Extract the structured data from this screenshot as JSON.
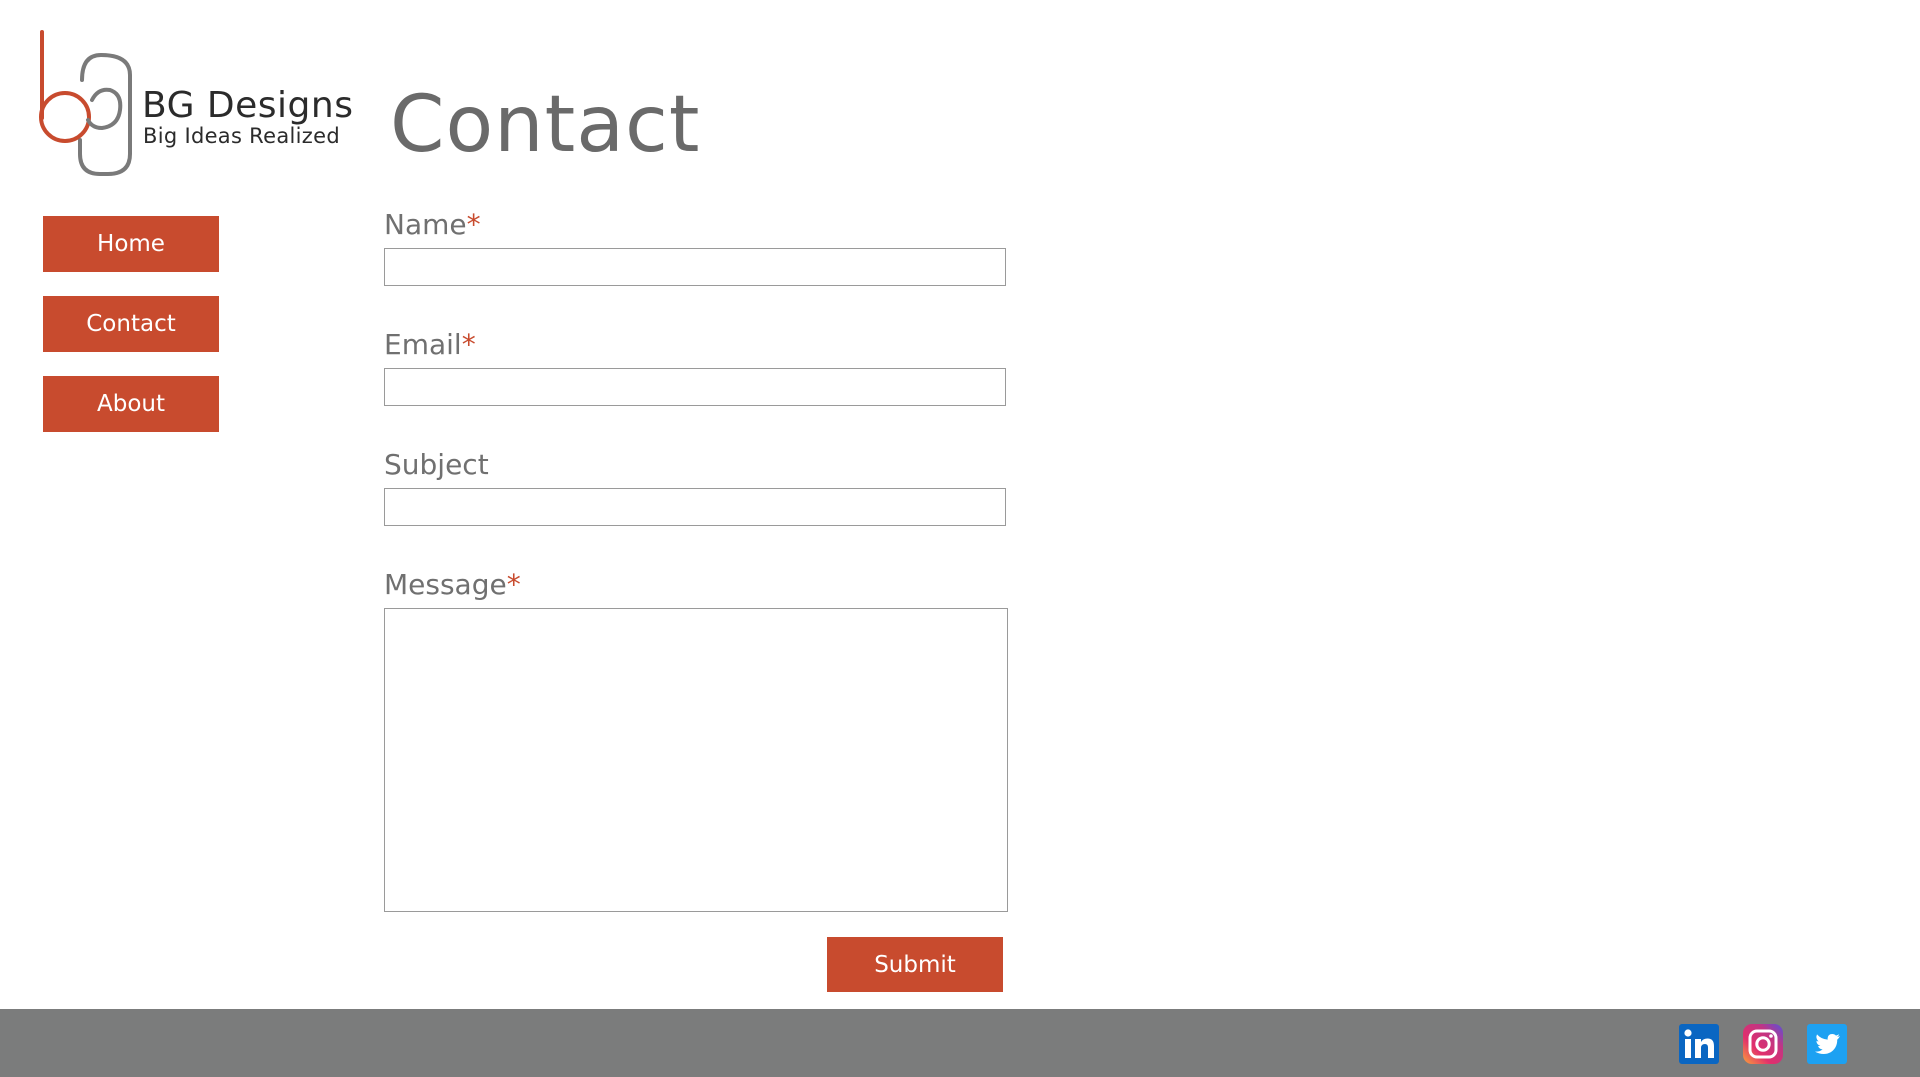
{
  "brand": {
    "name": "BG Designs",
    "tagline": "Big Ideas Realized",
    "colors": {
      "accent": "#c84b2e",
      "logo_gray": "#707070"
    }
  },
  "nav": {
    "items": [
      {
        "label": "Home"
      },
      {
        "label": "Contact"
      },
      {
        "label": "About"
      }
    ]
  },
  "page": {
    "title": "Contact"
  },
  "form": {
    "required_mark": "*",
    "fields": [
      {
        "label": "Name",
        "required": true,
        "value": ""
      },
      {
        "label": "Email",
        "required": true,
        "value": ""
      },
      {
        "label": "Subject",
        "required": false,
        "value": ""
      },
      {
        "label": "Message",
        "required": true,
        "value": ""
      }
    ],
    "submit_label": "Submit"
  },
  "footer": {
    "background": "#7b7c7c",
    "social": [
      {
        "icon": "linkedin-icon"
      },
      {
        "icon": "instagram-icon"
      },
      {
        "icon": "twitter-icon"
      }
    ]
  }
}
